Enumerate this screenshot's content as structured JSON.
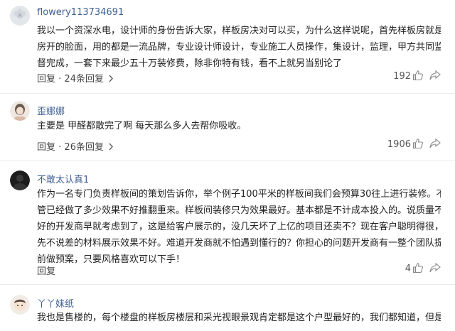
{
  "comments": [
    {
      "username": "flowery113734691",
      "lines": [
        "我以一个资深水电，设计师的身份告诉大家，样板房决对可以买，为什么这样说呢，首先样板房就是",
        "房开的脸面，用的都是一流品牌，专业设计师设计，专业施工人员操作，集设计，监理，甲方共同监",
        "督完成，一套下来最少五十万装修费，除非你特有钱，看不上就另当别论了"
      ],
      "reply_prefix": "回复",
      "reply_count": "24条回复",
      "likes": "192",
      "avatar_icon": "flower-avatar-icon"
    },
    {
      "username": "歪娜娜",
      "lines": [
        "主要是  甲醛都散完了啊  每天那么多人去帮你吸收。"
      ],
      "reply_prefix": "回复",
      "reply_count": "26条回复",
      "likes": "1906",
      "avatar_icon": "girl-avatar-icon"
    },
    {
      "username": "不敢太认真1",
      "lines": [
        "作为一名专门负责样板间的策划告诉你，举个例子100平米的样板间我们会预算30往上进行装修。不",
        "管已经做了多少效果不好推翻重来。样板间装修只为效果最好。基本都是不计成本投入的。说质量不",
        "好的开发商早就考虑到了，这是给客户展示的，没几天坏了上亿的项目还卖不？现在客户聪明得很，",
        "先不说差的材料展示效果不好。难道开发商就不怕遇到懂行的？你担心的问题开发商有一整个团队提",
        "前做预案，只要风格喜欢可以下手！"
      ],
      "reply_prefix": "回复",
      "reply_count": "",
      "likes": "4",
      "avatar_icon": "dark-avatar-icon"
    },
    {
      "username": "丫丫妹纸",
      "lines": [
        "我也是售楼的，每个楼盘的样板房楼层和采光视眼景观肯定都是这个户型最好的，我们都知道，但是"
      ],
      "reply_prefix": "",
      "reply_count": "",
      "likes": "",
      "avatar_icon": "cartoon-avatar-icon"
    }
  ],
  "colors": {
    "username": "#3f5f93",
    "text": "#222222",
    "meta": "#444444",
    "divider": "#ebebeb"
  }
}
